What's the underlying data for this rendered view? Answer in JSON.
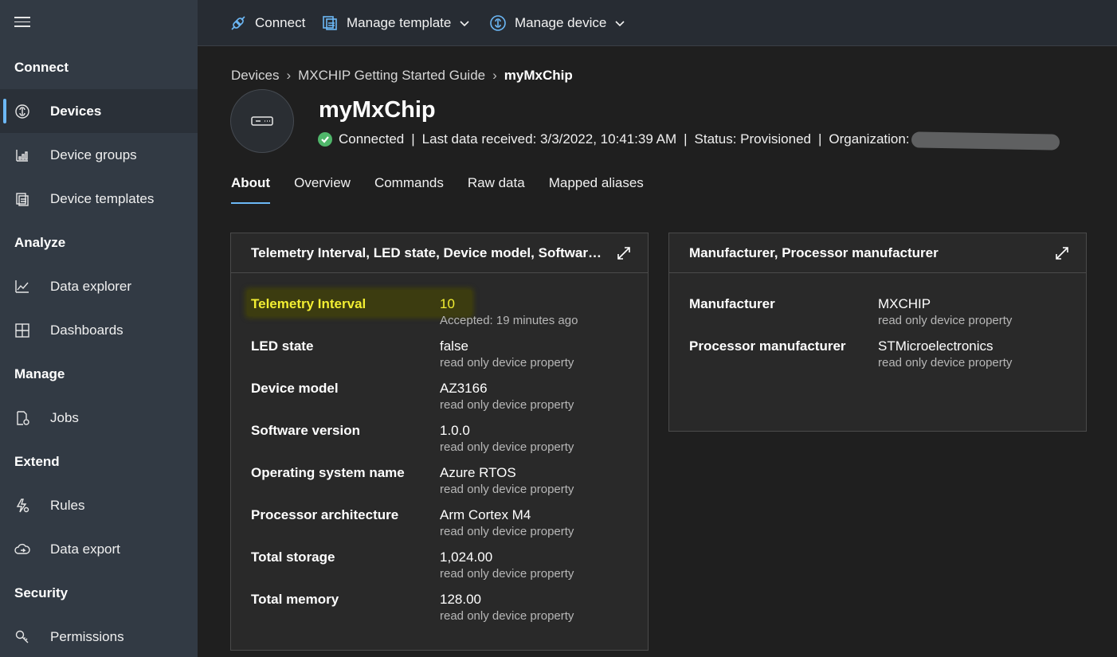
{
  "sidebar": {
    "sections": [
      {
        "title": "Connect",
        "items": [
          {
            "label": "Devices",
            "icon": "devices-icon",
            "active": true
          },
          {
            "label": "Device groups",
            "icon": "device-groups-icon"
          },
          {
            "label": "Device templates",
            "icon": "device-templates-icon"
          }
        ]
      },
      {
        "title": "Analyze",
        "items": [
          {
            "label": "Data explorer",
            "icon": "chart-line-icon"
          },
          {
            "label": "Dashboards",
            "icon": "dashboard-grid-icon"
          }
        ]
      },
      {
        "title": "Manage",
        "items": [
          {
            "label": "Jobs",
            "icon": "jobs-icon"
          }
        ]
      },
      {
        "title": "Extend",
        "items": [
          {
            "label": "Rules",
            "icon": "rules-icon"
          },
          {
            "label": "Data export",
            "icon": "cloud-export-icon"
          }
        ]
      },
      {
        "title": "Security",
        "items": [
          {
            "label": "Permissions",
            "icon": "key-icon"
          }
        ]
      }
    ]
  },
  "topbar": {
    "connect": "Connect",
    "manage_template": "Manage template",
    "manage_device": "Manage device"
  },
  "breadcrumb": {
    "items": [
      "Devices",
      "MXCHIP Getting Started Guide",
      "myMxChip"
    ]
  },
  "device": {
    "name": "myMxChip",
    "connection": "Connected",
    "last_data": "Last data received: 3/3/2022, 10:41:39 AM",
    "status": "Status: Provisioned",
    "organization_label": "Organization:"
  },
  "tabs": [
    "About",
    "Overview",
    "Commands",
    "Raw data",
    "Mapped aliases"
  ],
  "cards": {
    "left": {
      "title": "Telemetry Interval, LED state, Device model, Software ve...",
      "rows": [
        {
          "name": "Telemetry Interval",
          "value": "10",
          "sub": "Accepted: 19 minutes ago"
        },
        {
          "name": "LED state",
          "value": "false",
          "sub": "read only device property"
        },
        {
          "name": "Device model",
          "value": "AZ3166",
          "sub": "read only device property"
        },
        {
          "name": "Software version",
          "value": "1.0.0",
          "sub": "read only device property"
        },
        {
          "name": "Operating system name",
          "value": "Azure RTOS",
          "sub": "read only device property"
        },
        {
          "name": "Processor architecture",
          "value": "Arm Cortex M4",
          "sub": "read only device property"
        },
        {
          "name": "Total storage",
          "value": "1,024.00",
          "sub": "read only device property"
        },
        {
          "name": "Total memory",
          "value": "128.00",
          "sub": "read only device property"
        }
      ]
    },
    "right": {
      "title": "Manufacturer, Processor manufacturer",
      "rows": [
        {
          "name": "Manufacturer",
          "value": "MXCHIP",
          "sub": "read only device property"
        },
        {
          "name": "Processor manufacturer",
          "value": "STMicroelectronics",
          "sub": "read only device property"
        }
      ]
    }
  },
  "colors": {
    "accent": "#6cb8f6",
    "success": "#4fb66a",
    "highlight_text": "#f2ee32",
    "sidebar_bg": "#323a44"
  }
}
